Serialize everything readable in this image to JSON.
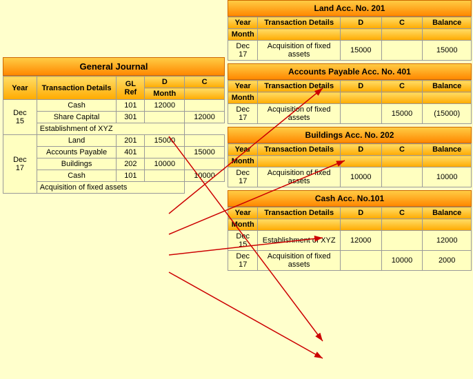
{
  "generalJournal": {
    "title": "General Journal",
    "headers": {
      "yearMonth": [
        "Year",
        "Month"
      ],
      "transactionDetails": "Transaction Details",
      "glRef": "GL Ref",
      "d": "D",
      "c": "C"
    },
    "entries": [
      {
        "date": "Dec\n15",
        "rows": [
          {
            "details": "Cash",
            "glRef": "101",
            "d": "12000",
            "c": ""
          },
          {
            "details": "Share Capital",
            "glRef": "301",
            "d": "",
            "c": "12000"
          },
          {
            "details": "Establishment of XYZ",
            "glRef": "",
            "d": "",
            "c": ""
          }
        ]
      },
      {
        "date": "Dec\n17",
        "rows": [
          {
            "details": "Land",
            "glRef": "201",
            "d": "15000",
            "c": ""
          },
          {
            "details": "Accounts Payable",
            "glRef": "401",
            "d": "",
            "c": "15000"
          },
          {
            "details": "Buildings",
            "glRef": "202",
            "d": "10000",
            "c": ""
          },
          {
            "details": "Cash",
            "glRef": "101",
            "d": "",
            "c": "10000"
          },
          {
            "details": "Acquisition of fixed assets",
            "glRef": "",
            "d": "",
            "c": ""
          }
        ]
      }
    ]
  },
  "ledgers": [
    {
      "title": "Land Acc. No. 201",
      "rows": [
        {
          "year": "Dec",
          "month": "17",
          "details": "Acquisition of fixed assets",
          "d": "15000",
          "c": "",
          "balance": "15000"
        }
      ]
    },
    {
      "title": "Accounts Payable Acc. No. 401",
      "rows": [
        {
          "year": "Dec",
          "month": "17",
          "details": "Acquisition of fixed assets",
          "d": "",
          "c": "15000",
          "balance": "(15000)"
        }
      ]
    },
    {
      "title": "Buildings Acc. No. 202",
      "rows": [
        {
          "year": "Dec",
          "month": "17",
          "details": "Acquisition of fixed assets",
          "d": "10000",
          "c": "",
          "balance": "10000"
        }
      ]
    },
    {
      "title": "Cash Acc. No.101",
      "rows": [
        {
          "year": "Dec",
          "month": "15",
          "details": "Establishment of XYZ",
          "d": "12000",
          "c": "",
          "balance": "12000"
        },
        {
          "year": "Dec",
          "month": "17",
          "details": "Acquisition of fixed assets",
          "d": "",
          "c": "10000",
          "balance": "2000"
        }
      ]
    }
  ]
}
